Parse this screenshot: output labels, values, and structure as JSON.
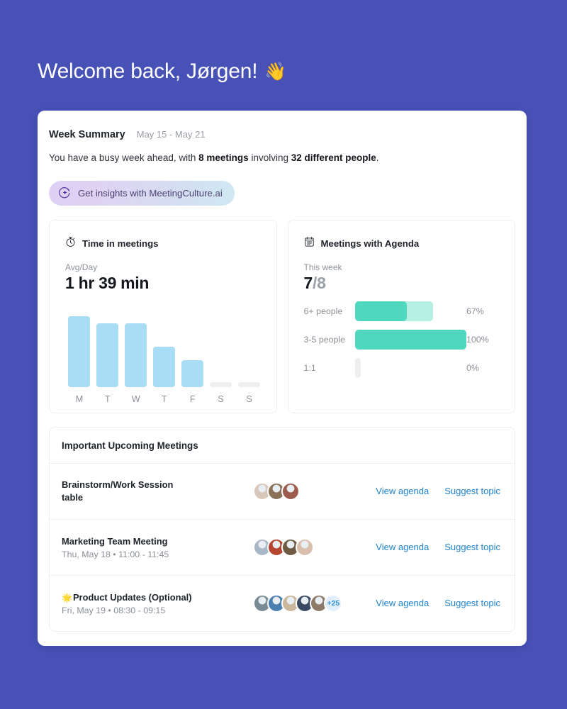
{
  "greeting": {
    "text": "Welcome back, Jørgen!",
    "emoji": "👋"
  },
  "summary": {
    "title": "Week Summary",
    "date_range": "May 15 - May 21",
    "sentence_part1": "You have a busy week ahead, with ",
    "meetings_count": "8 meetings",
    "sentence_part2": " involving ",
    "people_count": "32 different people",
    "sentence_part3": "."
  },
  "insights_button": {
    "label": "Get insights with MeetingCulture.ai",
    "icon": "sparkle-circle-icon",
    "gradient_from": "#ddd0f4",
    "gradient_to": "#cfe8f2",
    "text_color": "#4c4170"
  },
  "time_card": {
    "icon": "stopwatch-icon",
    "title": "Time in meetings",
    "meta": "Avg/Day",
    "value": "1 hr 39 min"
  },
  "agenda_card": {
    "icon": "calendar-agenda-icon",
    "title": "Meetings with Agenda",
    "meta": "This week",
    "value_numerator": "7",
    "value_denominator": "/8"
  },
  "meetings_panel": {
    "title": "Important Upcoming Meetings",
    "view_agenda_label": "View agenda",
    "suggest_topic_label": "Suggest topic",
    "rows": [
      {
        "name": "Brainstorm/Work Session",
        "name_line2": "table",
        "time": "",
        "emoji": "",
        "avatar_count": 3,
        "overflow": "",
        "avatar_colors": [
          "#d8c6bb",
          "#8a7258",
          "#9c5b4d"
        ]
      },
      {
        "name": "Marketing Team Meeting",
        "name_line2": "",
        "time": "Thu, May 18 • 11:00 - 11:45",
        "emoji": "",
        "avatar_count": 4,
        "overflow": "",
        "avatar_colors": [
          "#a9b8c6",
          "#b4452f",
          "#6f5a43",
          "#d9bfae"
        ]
      },
      {
        "name": "Product Updates (Optional)",
        "name_line2": "",
        "time": "Fri, May 19 • 08:30 - 09:15",
        "emoji": "🌟",
        "avatar_count": 5,
        "overflow": "+25",
        "avatar_colors": [
          "#7b8b95",
          "#4b7fb0",
          "#cbb79c",
          "#3a4a63",
          "#8e7a68"
        ]
      }
    ]
  },
  "chart_data": [
    {
      "type": "bar",
      "title": "Time in meetings",
      "subtitle": "Avg/Day",
      "value_label": "1 hr 39 min",
      "categories": [
        "M",
        "T",
        "W",
        "T",
        "F",
        "S",
        "S"
      ],
      "values": [
        100,
        90,
        90,
        57,
        38,
        7,
        7
      ],
      "ylabel": "",
      "xlabel": "",
      "ylim": [
        0,
        100
      ],
      "bar_color": "#A8DDF5",
      "empty_color": "#EEEFF0",
      "empty_indices": [
        5,
        6
      ],
      "grid": false,
      "legend": "none"
    },
    {
      "type": "bar",
      "orientation": "horizontal",
      "title": "Meetings with Agenda",
      "subtitle": "This week",
      "value_label": "7/8",
      "categories": [
        "6+ people",
        "3-5 people",
        "1:1"
      ],
      "values": [
        67,
        100,
        0
      ],
      "value_labels": [
        "67%",
        "100%",
        "0%"
      ],
      "track_values": [
        100,
        100,
        0
      ],
      "bar_color": "#4FD8BD",
      "track_color": "#B5F0E3",
      "empty_color": "#EDEEEF",
      "xlim": [
        0,
        100
      ],
      "grid": false,
      "legend": "none"
    }
  ],
  "theme": {
    "page_background": "#4751B6",
    "card_background": "#ffffff",
    "link_color": "#2083CC",
    "muted_text": "#8b9097",
    "heading_text": "#20242b"
  }
}
